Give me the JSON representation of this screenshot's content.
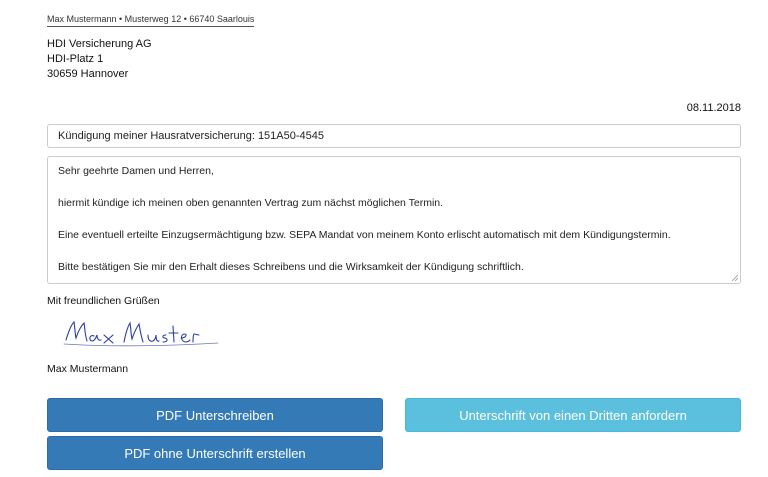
{
  "sender": {
    "line": "Max Mustermann • Musterweg 12 • 66740 Saarlouis"
  },
  "recipient": {
    "line1": "HDI Versicherung AG",
    "line2": "HDI-Platz 1",
    "line3": "30659 Hannover"
  },
  "letter": {
    "date": "08.11.2018",
    "subject": "Kündigung meiner Hausratversicherung: 151A50-4545",
    "body": {
      "salutation": "Sehr geehrte Damen und Herren,",
      "para1": "hiermit kündige ich meinen oben genannten Vertrag zum nächst möglichen Termin.",
      "para2": "Eine eventuell erteilte Einzugsermächtigung bzw. SEPA Mandat von meinem Konto erlischt automatisch mit dem Kündigungstermin.",
      "para3": "Bitte bestätigen Sie mir den Erhalt dieses Schreibens und die Wirksamkeit der Kündigung schriftlich."
    },
    "closing": "Mit freundlichen Grüßen",
    "signature_text": "Max Muster",
    "signer_name": "Max Mustermann"
  },
  "actions": {
    "sign_pdf": "PDF Unterschreiben",
    "request_third_party": "Unterschrift von einen Dritten anfordern",
    "pdf_without_signature": "PDF ohne Unterschrift erstellen"
  },
  "colors": {
    "primary": "#337ab7",
    "info": "#5bc0de",
    "signature_ink": "#2b3fa0"
  },
  "icons": {
    "resize_handle": "resize-grip-icon"
  }
}
